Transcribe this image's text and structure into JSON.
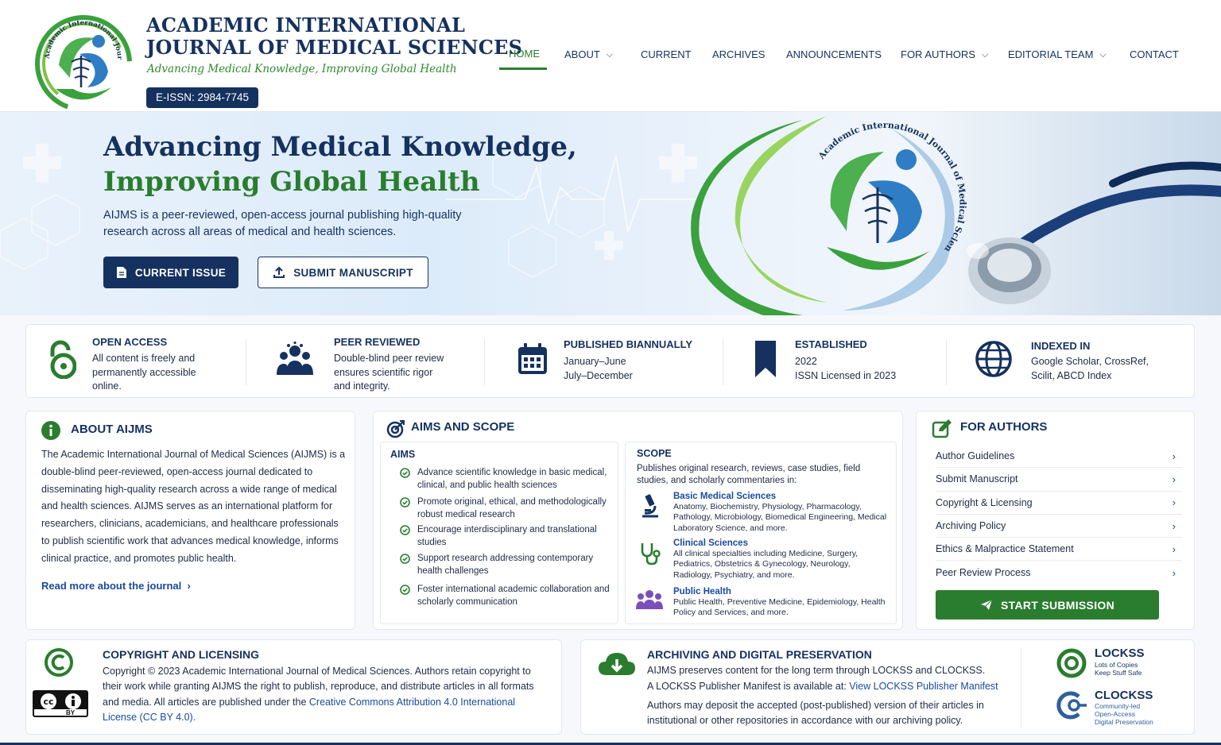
{
  "header": {
    "title_line1": "ACADEMIC INTERNATIONAL",
    "title_line2": "JOURNAL OF MEDICAL SCIENCES",
    "tagline": "Advancing Medical Knowledge, Improving Global Health",
    "issn": "E-ISSN: 2984-7745",
    "logo_text": "Academic International Journal of Medical Science",
    "nav": [
      {
        "label": "HOME",
        "active": true
      },
      {
        "label": "ABOUT",
        "dropdown": true
      },
      {
        "label": "CURRENT"
      },
      {
        "label": "ARCHIVES"
      },
      {
        "label": "ANNOUNCEMENTS"
      },
      {
        "label": "FOR AUTHORS",
        "dropdown": true
      },
      {
        "label": "EDITORIAL TEAM",
        "dropdown": true
      },
      {
        "label": "CONTACT"
      }
    ]
  },
  "hero": {
    "title_line1": "Advancing Medical Knowledge,",
    "title_line2": "Improving Global Health",
    "description": "AIJMS is a peer-reviewed, open-access journal publishing high-quality research across all areas of medical and health sciences.",
    "primary_button": "CURRENT ISSUE",
    "secondary_button": "SUBMIT MANUSCRIPT"
  },
  "features": [
    {
      "icon": "open-lock-icon",
      "title": "OPEN ACCESS",
      "text_lines": [
        "All content is freely and",
        "permanently accessible",
        "online."
      ]
    },
    {
      "icon": "people-icon",
      "title": "PEER REVIEWED",
      "text_lines": [
        "Double-blind peer review",
        "ensures scientific rigor",
        "and integrity."
      ]
    },
    {
      "icon": "calendar-icon",
      "title": "PUBLISHED BIANNUALLY",
      "text_lines": [
        "January–June",
        "July–December"
      ]
    },
    {
      "icon": "bookmark-icon",
      "title": "ESTABLISHED",
      "text_lines": [
        "2022",
        "ISSN Licensed in 2023"
      ]
    },
    {
      "icon": "globe-icon",
      "title": "INDEXED IN",
      "text_lines": [
        "Google Scholar, CrossRef,",
        "Scilit, ABCD Index"
      ]
    }
  ],
  "about": {
    "title": "ABOUT AIJMS",
    "body": "The Academic International Journal of Medical Sciences (AIJMS) is a double-blind peer-reviewed, open-access journal dedicated to disseminating high-quality research across a wide range of medical and health sciences. AIJMS serves as an international platform for researchers, clinicians, academicians, and healthcare professionals to publish scientific work that advances medical knowledge, informs clinical practice, and promotes public health.",
    "read_more": "Read more about the journal"
  },
  "aims_scope": {
    "title": "AIMS AND SCOPE",
    "aims_heading": "AIMS",
    "aims": [
      "Advance scientific knowledge in basic medical, clinical, and public health sciences",
      "Promote original, ethical, and methodologically robust medical research",
      "Encourage interdisciplinary and translational studies",
      "Support research addressing contemporary health challenges",
      "Foster international academic collaboration and scholarly communication"
    ],
    "scope_heading": "SCOPE",
    "scope_intro": "Publishes original research, reviews, case studies, field studies, and scholarly commentaries in:",
    "scope_items": [
      {
        "icon": "microscope-icon",
        "title": "Basic Medical Sciences",
        "desc": "Anatomy, Biochemistry, Physiology, Pharmacology, Pathology, Microbiology, Biomedical Engineering, Medical Laboratory Science, and more."
      },
      {
        "icon": "stethoscope-icon",
        "title": "Clinical Sciences",
        "desc": "All clinical specialties including Medicine, Surgery, Pediatrics, Obstetrics & Gynecology, Neurology, Radiology, Psychiatry, and more."
      },
      {
        "icon": "group-icon",
        "title": "Public Health",
        "desc": "Public Health, Preventive Medicine, Epidemiology, Health Policy and Services, and more."
      }
    ]
  },
  "for_authors": {
    "title": "FOR AUTHORS",
    "links": [
      "Author Guidelines",
      "Submit Manuscript",
      "Copyright & Licensing",
      "Archiving Policy",
      "Ethics & Malpractice Statement",
      "Peer Review Process"
    ],
    "button": "START SUBMISSION"
  },
  "copyright": {
    "title": "COPYRIGHT AND LICENSING",
    "body_start": "Copyright © 2023 Academic International Journal of Medical Sciences. Authors retain copyright to their work while granting AIJMS the right to publish, reproduce, and distribute articles in all formats and media. All articles are published under the ",
    "license_link": "Creative Commons Attribution 4.0 International License (CC BY 4.0).",
    "badge_cc": "cc",
    "badge_by": "BY"
  },
  "archiving": {
    "title": "ARCHIVING AND DIGITAL PRESERVATION",
    "line1": "AIJMS preserves content for the long term through LOCKSS and CLOCKSS.",
    "line2_start": "A LOCKSS Publisher Manifest is available at: ",
    "manifest_link": "View LOCKSS Publisher Manifest",
    "line3": "Authors may deposit the accepted (post-published) version of their articles in institutional or other repositories in accordance with our archiving policy.",
    "lockss": {
      "name": "LOCKSS",
      "tag1": "Lots of Copies",
      "tag2": "Keep Stuff Safe"
    },
    "clockss": {
      "name": "CLOCKSS",
      "tag1": "Community-led",
      "tag2": "Open-Access",
      "tag3": "Digital Preservation"
    }
  },
  "colors": {
    "navy": "#15315f",
    "green": "#2a7d2e",
    "link": "#1a4a9c"
  }
}
